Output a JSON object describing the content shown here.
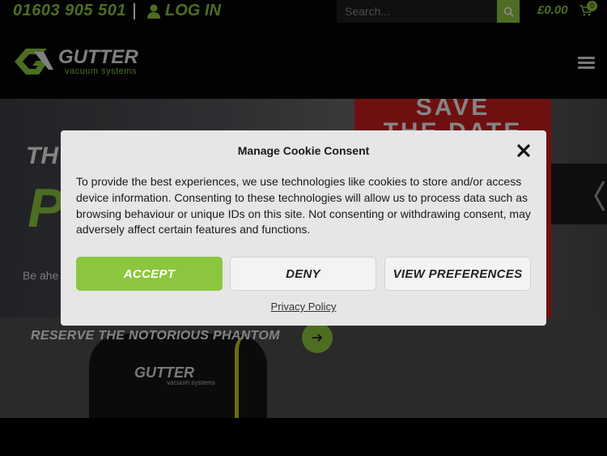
{
  "topbar": {
    "phone": "01603 905 501",
    "login_label": "LOG IN",
    "search_placeholder": "Search...",
    "cart_total": "£0.00",
    "cart_count": "0"
  },
  "header": {
    "logo_main": "GUTTER",
    "logo_sub": "vacuum systems"
  },
  "hero": {
    "title_line1": "TH",
    "title_line2": "P",
    "subtitle": "Be ahe",
    "sign_line1": "SAVE",
    "sign_line2": "THE DATE",
    "cta_label": "RESERVE THE NOTORIOUS PHANTOM",
    "vac_logo": "GUTTER",
    "vac_logo_sub": "vacuum systems"
  },
  "cookie_modal": {
    "title": "Manage Cookie Consent",
    "body": "To provide the best experiences, we use technologies like cookies to store and/or access device information. Consenting to these technologies will allow us to process data such as browsing behaviour or unique IDs on this site. Not consenting or withdrawing consent, may adversely affect certain features and functions.",
    "accept_label": "ACCEPT",
    "deny_label": "DENY",
    "prefs_label": "VIEW PREFERENCES",
    "privacy_label": "Privacy Policy"
  },
  "colors": {
    "brand_green": "#8cc63f",
    "background": "#050505",
    "modal_bg": "#e6e6e6"
  },
  "icons": {
    "login": "user-icon",
    "search": "search-icon",
    "cart": "cart-icon",
    "menu": "hamburger-menu-icon",
    "close": "close-icon",
    "cta": "arrow-right-icon"
  }
}
